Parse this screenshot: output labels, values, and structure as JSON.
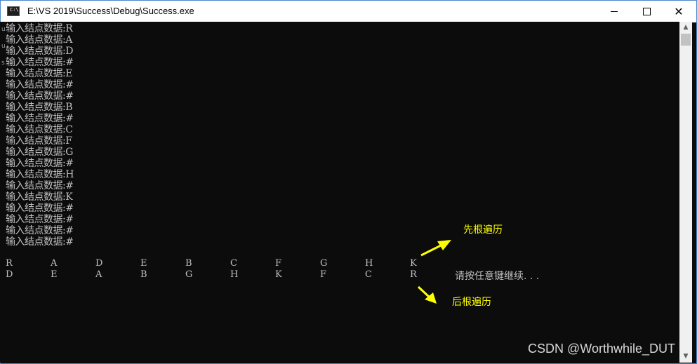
{
  "window": {
    "title": "E:\\VS 2019\\Success\\Debug\\Success.exe",
    "icon_label": "C:\\",
    "controls": [
      "minimize-icon",
      "maximize-icon",
      "close-icon"
    ]
  },
  "console": {
    "background": "#0c0c0c",
    "text_color": "#c0c0c0",
    "input_lines": [
      "输入结点数据:R",
      "输入结点数据:A",
      "输入结点数据:D",
      "输入结点数据:#",
      "输入结点数据:E",
      "输入结点数据:#",
      "输入结点数据:#",
      "输入结点数据:B",
      "输入结点数据:#",
      "输入结点数据:C",
      "输入结点数据:F",
      "输入结点数据:G",
      "输入结点数据:#",
      "输入结点数据:H",
      "输入结点数据:#",
      "输入结点数据:K",
      "输入结点数据:#",
      "输入结点数据:#",
      "输入结点数据:#",
      "输入结点数据:#"
    ],
    "preorder": [
      "R",
      "A",
      "D",
      "E",
      "B",
      "C",
      "F",
      "G",
      "H",
      "K"
    ],
    "postorder": [
      "D",
      "E",
      "A",
      "B",
      "G",
      "H",
      "K",
      "F",
      "C",
      "R"
    ],
    "prompt": "请按任意键继续. . ."
  },
  "annotations": {
    "color": "#ffff00",
    "preorder_label": "先根遍历",
    "postorder_label": "后根遍历"
  },
  "watermark": "CSDN @Worthwhile_DUT",
  "side_glyphs": [
    "u",
    "u",
    "s"
  ]
}
